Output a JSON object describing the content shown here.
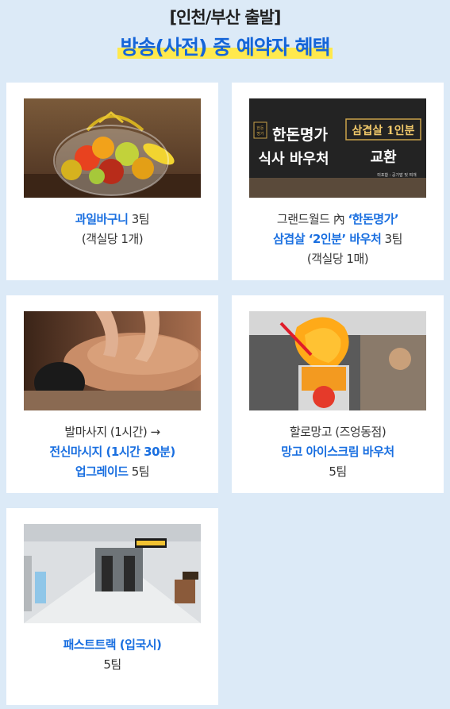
{
  "header": {
    "subtitle": "[인천/부산 출발]",
    "title": "방송(사전) 중 예약자 혜택"
  },
  "cards": [
    {
      "lines": [
        [
          {
            "t": "과일바구니",
            "hl": true
          },
          {
            "t": " 3팀",
            "hl": false
          }
        ],
        [
          {
            "t": "(객실당 1개)",
            "hl": false
          }
        ]
      ]
    },
    {
      "voucher": {
        "brand": "한돈명가",
        "line1": "한돈명가",
        "line2": "식사 바우처",
        "right1": "삼겹살 1인분",
        "right2": "교환",
        "note": "미포함 : 공기밥 및 찌개"
      },
      "lines": [
        [
          {
            "t": "그랜드월드 內 ",
            "hl": false
          },
          {
            "t": "‘한돈명가’",
            "hl": true
          }
        ],
        [
          {
            "t": "삼겹살 ‘2인분’ 바우처",
            "hl": true
          },
          {
            "t": " 3팀",
            "hl": false
          }
        ],
        [
          {
            "t": "(객실당 1매)",
            "hl": false
          }
        ]
      ]
    },
    {
      "lines": [
        [
          {
            "t": "발마사지 (1시간) →",
            "hl": false
          }
        ],
        [
          {
            "t": "전신마시지 (1시간 30분)",
            "hl": true
          }
        ],
        [
          {
            "t": "업그레이드",
            "hl": true
          },
          {
            "t": " 5팀",
            "hl": false
          }
        ]
      ]
    },
    {
      "lines": [
        [
          {
            "t": "할로망고 (즈엉동점)",
            "hl": false
          }
        ],
        [
          {
            "t": "망고 아이스크림 바우처",
            "hl": true
          }
        ],
        [
          {
            "t": "5팀",
            "hl": false
          }
        ]
      ]
    },
    {
      "lines": [
        [
          {
            "t": "패스트트랙 (입국시)",
            "hl": true
          }
        ],
        [
          {
            "t": "5팀",
            "hl": false
          }
        ]
      ]
    }
  ],
  "colors": {
    "accent": "#1a6fe0",
    "highlight": "#ffe94d",
    "background": "#dceaf7"
  }
}
